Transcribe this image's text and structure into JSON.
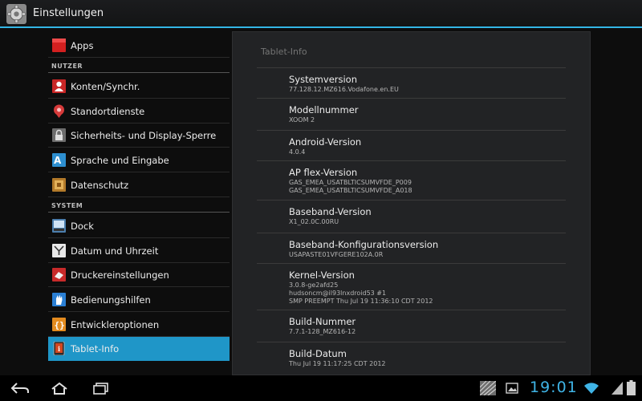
{
  "actionbar": {
    "title": "Einstellungen",
    "icon": "gear-icon"
  },
  "sidebar": {
    "top_item": {
      "label": "Apps",
      "icon": "apps-icon"
    },
    "section_user": "NUTZER",
    "user_items": [
      {
        "label": "Konten/Synchr.",
        "icon": "accounts-icon"
      },
      {
        "label": "Standortdienste",
        "icon": "location-icon"
      },
      {
        "label": "Sicherheits- und Display-Sperre",
        "icon": "lock-icon"
      },
      {
        "label": "Sprache und Eingabe",
        "icon": "language-icon"
      },
      {
        "label": "Datenschutz",
        "icon": "privacy-icon"
      }
    ],
    "section_system": "SYSTEM",
    "system_items": [
      {
        "label": "Dock",
        "icon": "dock-icon"
      },
      {
        "label": "Datum und Uhrzeit",
        "icon": "clock-icon"
      },
      {
        "label": "Druckereinstellungen",
        "icon": "printer-icon"
      },
      {
        "label": "Bedienungshilfen",
        "icon": "accessibility-icon"
      },
      {
        "label": "Entwickleroptionen",
        "icon": "developer-icon"
      },
      {
        "label": "Tablet-Info",
        "icon": "tablet-info-icon",
        "selected": true
      }
    ]
  },
  "panel": {
    "title": "Tablet-Info",
    "rows": [
      {
        "title": "Systemversion",
        "lines": [
          "77.128.12.MZ616.Vodafone.en.EU"
        ]
      },
      {
        "title": "Modellnummer",
        "lines": [
          "XOOM 2"
        ]
      },
      {
        "title": "Android-Version",
        "lines": [
          "4.0.4"
        ]
      },
      {
        "title": "AP flex-Version",
        "lines": [
          "GAS_EMEA_USATBLTICSUMVFDE_P009",
          "GAS_EMEA_USATBLTICSUMVFDE_A018"
        ]
      },
      {
        "title": "Baseband-Version",
        "lines": [
          "X1_02.0C.00RU"
        ]
      },
      {
        "title": "Baseband-Konfigurationsversion",
        "lines": [
          "USAPASTE01VFGERE102A.0R"
        ]
      },
      {
        "title": "Kernel-Version",
        "lines": [
          "3.0.8-ge2afd25",
          "hudsoncm@il93lnxdroid53 #1",
          "SMP PREEMPT Thu Jul 19 11:36:10 CDT 2012"
        ]
      },
      {
        "title": "Build-Nummer",
        "lines": [
          "7.7.1-128_MZ616-12"
        ]
      },
      {
        "title": "Build-Datum",
        "lines": [
          "Thu Jul 19 11:17:25 CDT 2012"
        ]
      }
    ]
  },
  "statusbar": {
    "time": "19:01"
  },
  "colors": {
    "accent": "#33b5e5",
    "selected": "#1f96c8",
    "panel": "#222325"
  }
}
